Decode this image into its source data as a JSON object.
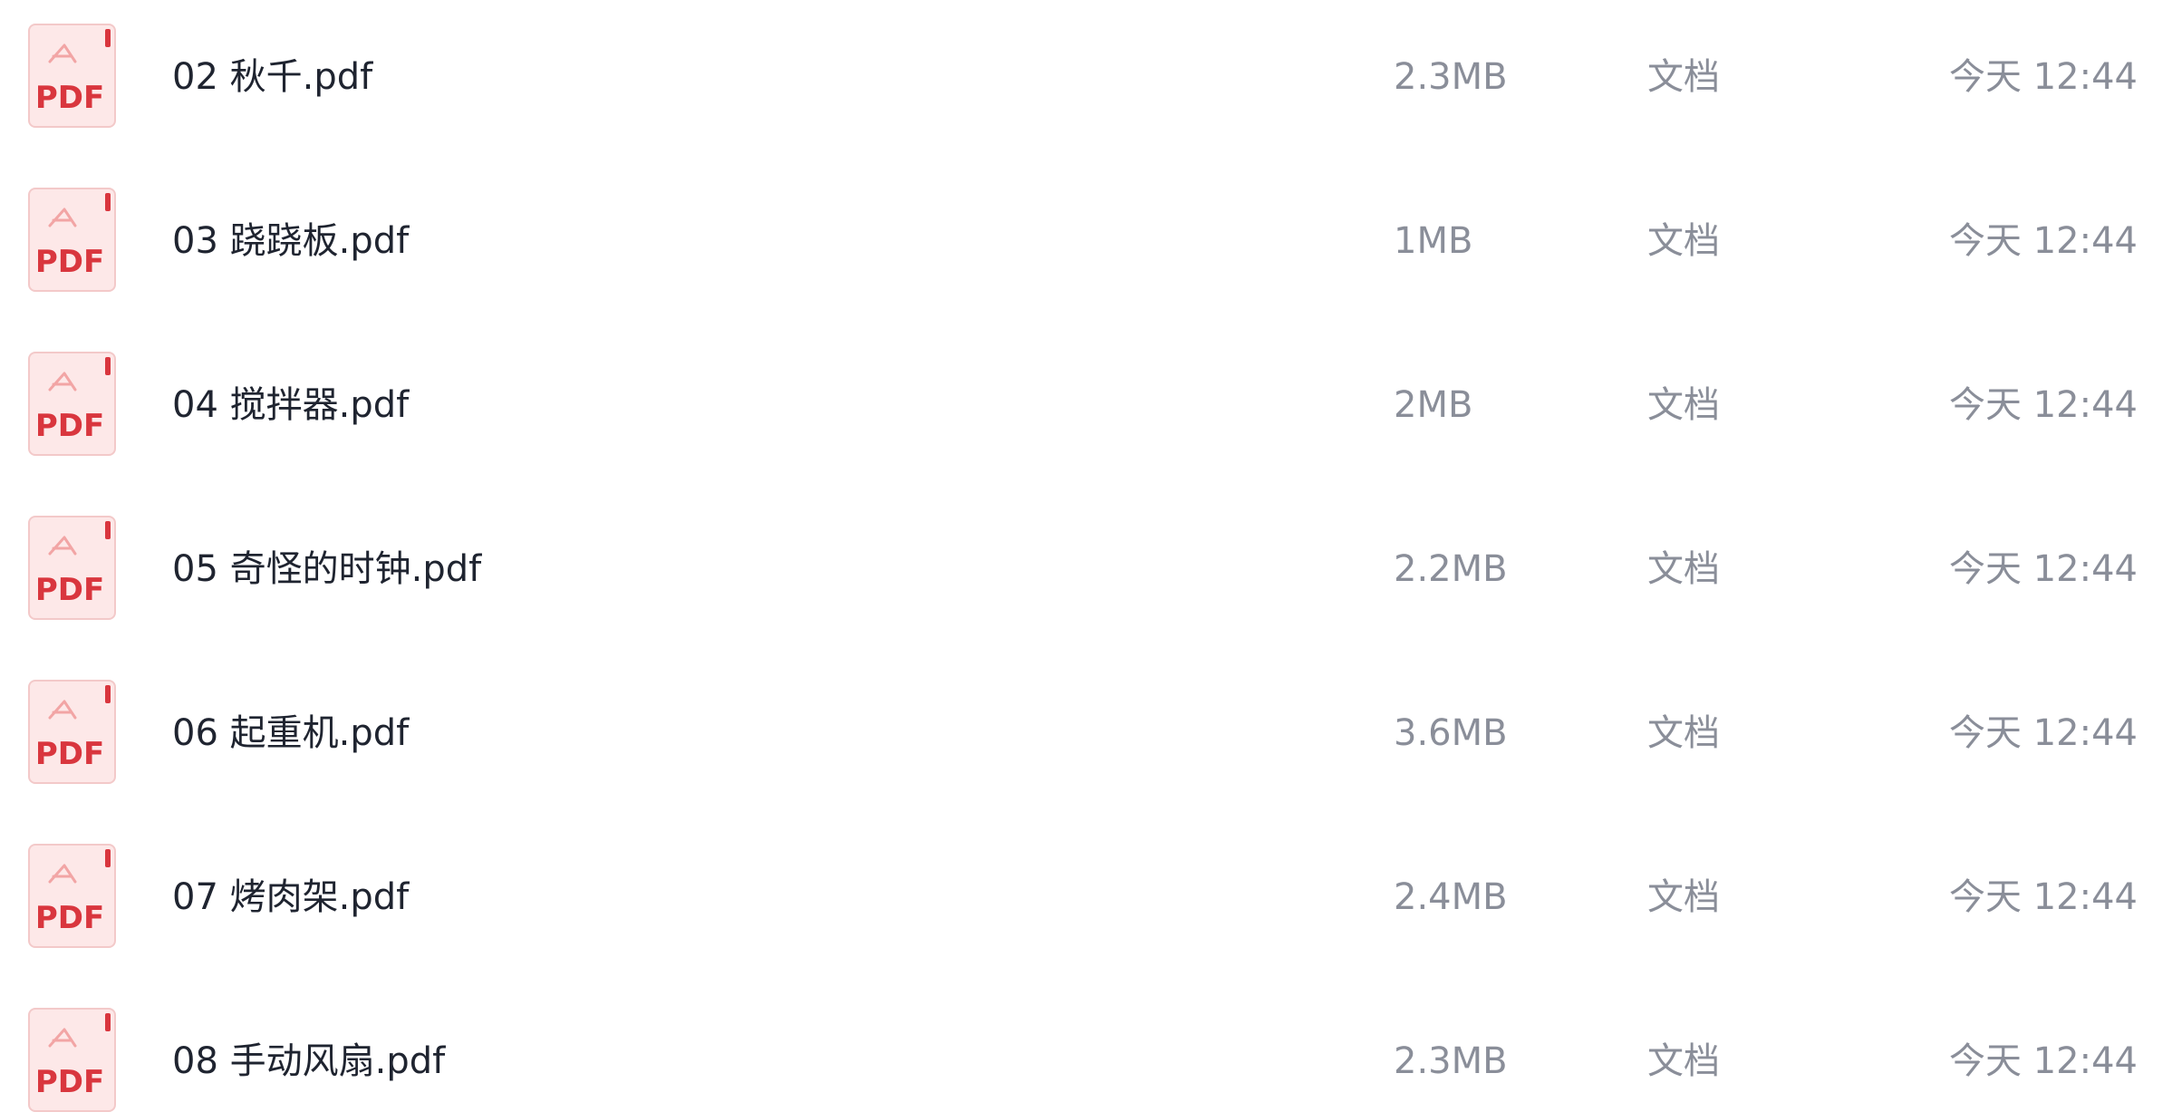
{
  "files": [
    {
      "name": "02 秋千.pdf",
      "size": "2.3MB",
      "type": "文档",
      "time": "今天 12:44",
      "icon": "pdf-file-icon",
      "icon_label": "PDF"
    },
    {
      "name": "03 跷跷板.pdf",
      "size": "1MB",
      "type": "文档",
      "time": "今天 12:44",
      "icon": "pdf-file-icon",
      "icon_label": "PDF"
    },
    {
      "name": "04 搅拌器.pdf",
      "size": "2MB",
      "type": "文档",
      "time": "今天 12:44",
      "icon": "pdf-file-icon",
      "icon_label": "PDF"
    },
    {
      "name": "05 奇怪的时钟.pdf",
      "size": "2.2MB",
      "type": "文档",
      "time": "今天 12:44",
      "icon": "pdf-file-icon",
      "icon_label": "PDF"
    },
    {
      "name": "06 起重机.pdf",
      "size": "3.6MB",
      "type": "文档",
      "time": "今天 12:44",
      "icon": "pdf-file-icon",
      "icon_label": "PDF"
    },
    {
      "name": "07 烤肉架.pdf",
      "size": "2.4MB",
      "type": "文档",
      "time": "今天 12:44",
      "icon": "pdf-file-icon",
      "icon_label": "PDF"
    },
    {
      "name": "08 手动风扇.pdf",
      "size": "2.3MB",
      "type": "文档",
      "time": "今天 12:44",
      "icon": "pdf-file-icon",
      "icon_label": "PDF"
    }
  ],
  "colors": {
    "pdf_red": "#d9363e",
    "pdf_bg": "#fde8e8",
    "name_text": "#1f2430",
    "meta_text": "#8a8e99"
  }
}
